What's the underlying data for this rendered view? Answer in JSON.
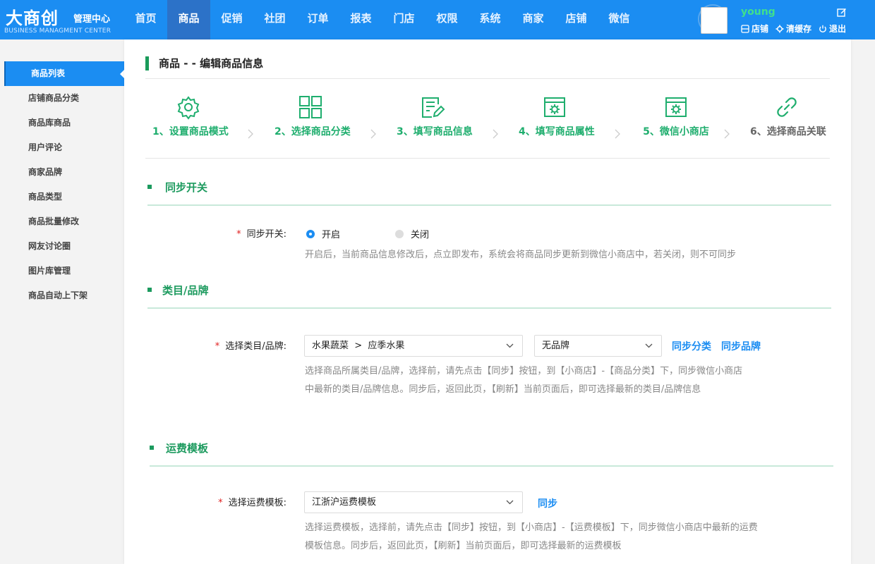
{
  "header": {
    "logo_main": "大商创",
    "logo_sub": "管理中心",
    "logo_en": "BUSINESS MANAGMENT CENTER",
    "nav": [
      "首页",
      "商品",
      "促销",
      "社团",
      "订单",
      "报表",
      "门店",
      "权限",
      "系统",
      "商家",
      "店铺",
      "微信"
    ],
    "active_nav": "商品",
    "username": "young",
    "links": {
      "store": "店铺",
      "clear_cache": "清缓存",
      "logout": "退出"
    }
  },
  "sidebar": {
    "items": [
      "商品列表",
      "店铺商品分类",
      "商品库商品",
      "用户评论",
      "商家品牌",
      "商品类型",
      "商品批量修改",
      "网友讨论圈",
      "图片库管理",
      "商品自动上下架"
    ],
    "active": "商品列表"
  },
  "page": {
    "title": "商品 - - 编辑商品信息",
    "steps": [
      {
        "label": "1、设置商品模式",
        "icon": "gear-icon"
      },
      {
        "label": "2、选择商品分类",
        "icon": "grid-icon"
      },
      {
        "label": "3、填写商品信息",
        "icon": "document-edit-icon"
      },
      {
        "label": "4、填写商品属性",
        "icon": "window-gear-icon"
      },
      {
        "label": "5、微信小商店",
        "icon": "window-gear-icon"
      },
      {
        "label": "6、选择商品关联",
        "icon": "link-icon"
      }
    ]
  },
  "sync": {
    "heading": "同步开关",
    "label": "同步开关:",
    "on_label": "开启",
    "off_label": "关闭",
    "selected": "开启",
    "hint": "开启后，当前商品信息修改后，点立即发布，系统会将商品同步更新到微信小商店中，若关闭，则不可同步"
  },
  "category": {
    "heading": "类目/品牌",
    "label": "选择类目/品牌:",
    "category_value": "水果蔬菜  >  应季水果",
    "brand_value": "无品牌",
    "sync_category": "同步分类",
    "sync_brand": "同步品牌",
    "hint_line1": "选择商品所属类目/品牌，选择前，请先点击【同步】按钮，到【小商店】-【商品分类】下，同步微信小商店",
    "hint_line2": "中最新的类目/品牌信息。同步后，返回此页，【刷新】当前页面后，即可选择最新的类目/品牌信息"
  },
  "shipping": {
    "heading": "运费模板",
    "label": "选择运费模板:",
    "template_value": "江浙沪运费模板",
    "sync": "同步",
    "hint_line1": "选择运费模板，选择前，请先点击【同步】按钮，到【小商店】-【运费模板】下，同步微信小商店中最新的运费",
    "hint_line2": "模板信息。同步后，返回此页，【刷新】当前页面后，即可选择最新的运费模板"
  },
  "colors": {
    "brand_blue": "#1b8df2",
    "accent_green": "#1c9a5e",
    "username_green": "#40e08c"
  }
}
